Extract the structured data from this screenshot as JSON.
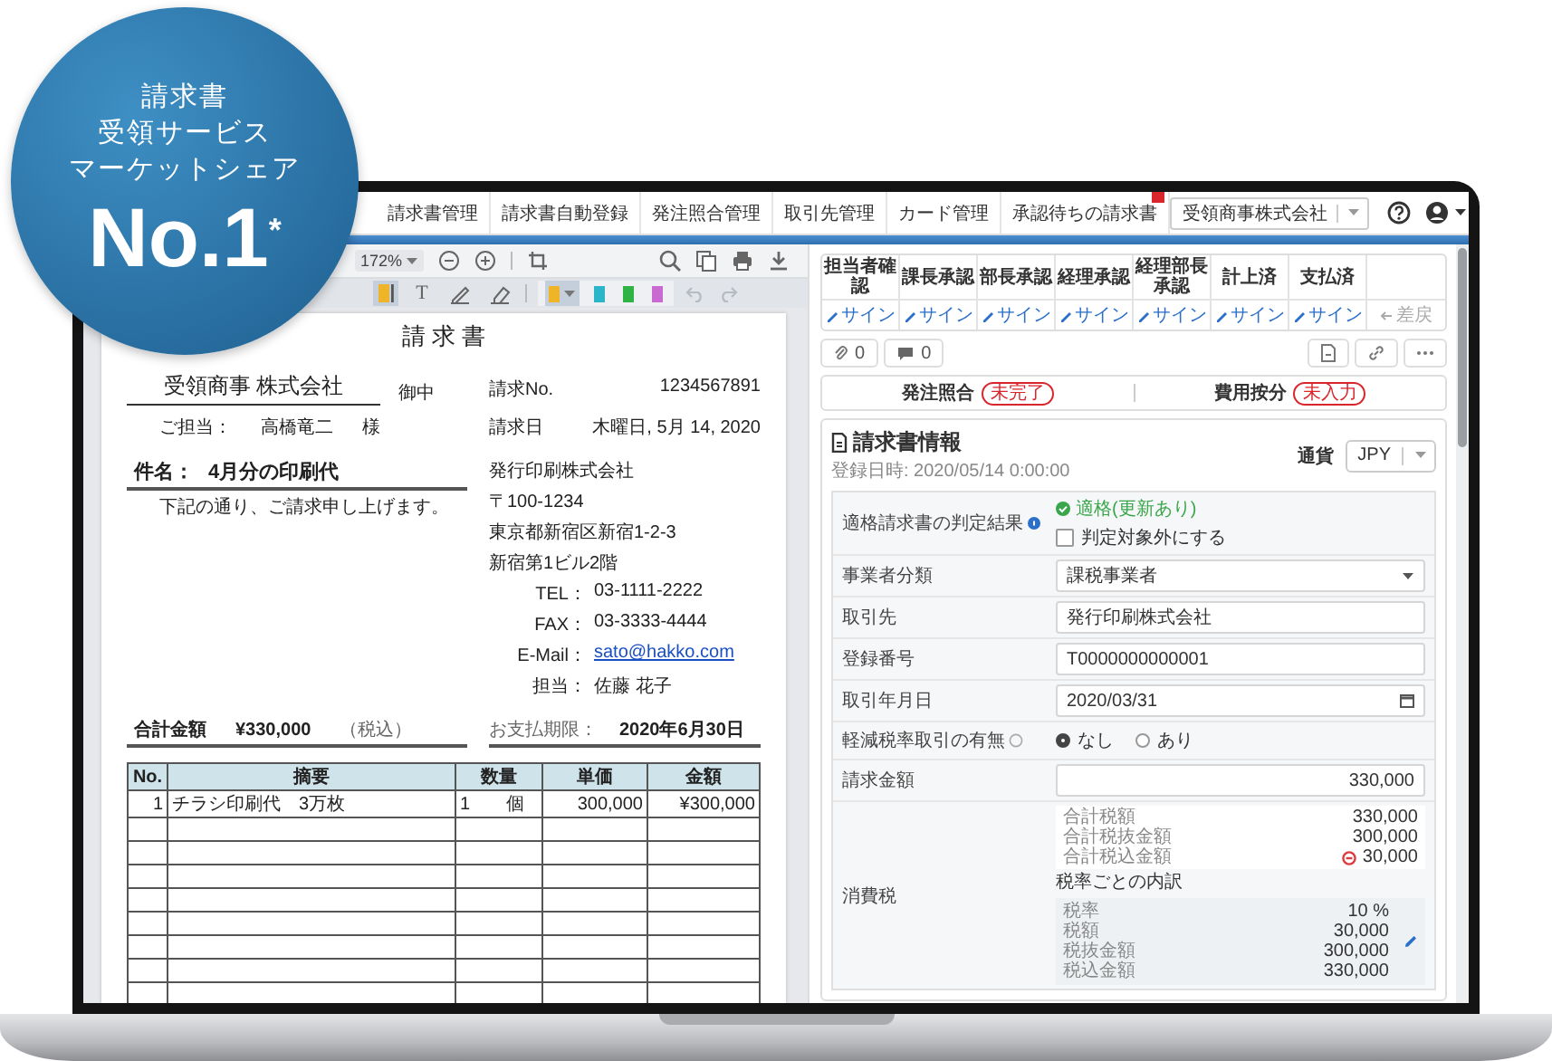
{
  "badge": {
    "lines": [
      "請求書",
      "受領サービス",
      "マーケットシェア"
    ],
    "rank": "No.1$^{*}$"
  },
  "nav": {
    "items": [
      {
        "label": "請求書管理",
        "notice": false
      },
      {
        "label": "請求書自動登録",
        "notice": false
      },
      {
        "label": "発注照合管理",
        "notice": false
      },
      {
        "label": "取引先管理",
        "notice": false
      },
      {
        "label": "カード管理",
        "notice": false
      },
      {
        "label": "承認待ちの請求書",
        "notice": true
      }
    ],
    "company": "受領商事株式会社"
  },
  "viewer": {
    "zoom": "172%",
    "tools": [
      {
        "kind": "highlight",
        "selected": true
      },
      {
        "kind": "text",
        "glyph": "T",
        "selected": false
      },
      {
        "kind": "pen",
        "selected": false
      },
      {
        "kind": "eraser",
        "selected": false
      }
    ],
    "highlight_colors": [
      {
        "color": "#f0b429",
        "selected": true
      },
      {
        "color": "#2bb5c9",
        "selected": false
      },
      {
        "color": "#2fb344",
        "selected": false
      },
      {
        "color": "#c86ad1",
        "selected": false
      }
    ],
    "history": [
      {
        "kind": "undo",
        "disabled": true
      },
      {
        "kind": "redo",
        "disabled": true
      }
    ]
  },
  "document": {
    "title": "請 求 書",
    "recipient": "受領商事 株式会社",
    "honorific": "御中",
    "contact_label": "ご担当：",
    "contact_name": "高橋竜二",
    "contact_suffix": "様",
    "meta": [
      {
        "label": "請求No.",
        "value": "1234567891"
      },
      {
        "label": "請求日",
        "value": "木曜日, 5月 14, 2020"
      }
    ],
    "subject_label": "件名：",
    "subject": "4月分の印刷代",
    "note": "下記の通り、ご請求申し上げます。",
    "issuer": {
      "name": "発行印刷株式会社",
      "address": [
        "〒100-1234",
        "東京都新宿区新宿1-2-3",
        "新宿第1ビル2階"
      ],
      "contacts": [
        {
          "kind": "text",
          "label": "TEL：",
          "value": "03-1111-2222"
        },
        {
          "kind": "text",
          "label": "FAX：",
          "value": "03-3333-4444"
        },
        {
          "kind": "link",
          "label": "E-Mail：",
          "value": "sato@hakko.com"
        },
        {
          "kind": "text",
          "label": "担当：",
          "value": "佐藤 花子"
        }
      ]
    },
    "total_label": "合計金額",
    "total": "¥330,000",
    "tax_note": "（税込）",
    "due_label": "お支払期限：",
    "due": "2020年6月30日",
    "table": {
      "columns": [
        "No.",
        "摘要",
        "数量",
        "単価",
        "金額"
      ],
      "rows": [
        [
          "1",
          "チラシ印刷代　3万枚",
          "1　　個",
          "300,000",
          "¥300,000"
        ]
      ]
    }
  },
  "side": {
    "approvals": [
      {
        "kind": "sign",
        "step": "担当者確認",
        "action": "サイン",
        "disabled": false
      },
      {
        "kind": "sign",
        "step": "課長承認",
        "action": "サイン",
        "disabled": false
      },
      {
        "kind": "sign",
        "step": "部長承認",
        "action": "サイン",
        "disabled": false
      },
      {
        "kind": "sign",
        "step": "経理承認",
        "action": "サイン",
        "disabled": false
      },
      {
        "kind": "sign",
        "step": "経理部長承認",
        "action": "サイン",
        "disabled": false
      },
      {
        "kind": "sign",
        "step": "計上済",
        "action": "サイン",
        "disabled": false
      },
      {
        "kind": "sign",
        "step": "支払済",
        "action": "サイン",
        "disabled": false
      },
      {
        "kind": "return",
        "action": "差戻",
        "disabled": true
      }
    ],
    "counters": [
      {
        "kind": "attachment",
        "count": "0"
      },
      {
        "kind": "comment",
        "count": "0"
      }
    ],
    "actions": [
      {
        "kind": "document"
      },
      {
        "kind": "link"
      },
      {
        "kind": "more"
      }
    ],
    "status": [
      {
        "label": "発注照合",
        "tag": "未完了"
      },
      {
        "label": "費用按分",
        "tag": "未入力"
      }
    ]
  },
  "invoice_info": {
    "title": "請求書情報",
    "registered": "登録日時: 2020/05/14 0:00:00",
    "currency_label": "通貨",
    "currency": "JPY",
    "rows": [
      {
        "kind": "check",
        "label": "適格請求書の判定結果",
        "help": true,
        "result": "適格(更新あり)",
        "checkbox": "判定対象外にする",
        "checked": false
      },
      {
        "kind": "select",
        "label": "事業者分類",
        "value": "課税事業者"
      },
      {
        "kind": "input",
        "label": "取引先",
        "value": "発行印刷株式会社"
      },
      {
        "kind": "input",
        "label": "登録番号",
        "value": "T0000000000001"
      },
      {
        "kind": "date",
        "label": "取引年月日",
        "value": "2020/03/31"
      },
      {
        "kind": "radio",
        "label": "軽減税率取引の有無",
        "hint": true,
        "options": [
          {
            "label": "なし",
            "selected": true
          },
          {
            "label": "あり",
            "selected": false
          }
        ]
      },
      {
        "kind": "amount",
        "label": "請求金額",
        "value": "330,000"
      },
      {
        "kind": "tax",
        "label": "消費税",
        "totals": [
          {
            "label": "合計税額",
            "value": "330,000",
            "warning": false
          },
          {
            "label": "合計税抜金額",
            "value": "300,000",
            "warning": false
          },
          {
            "label": "合計税込金額",
            "value": "30,000",
            "warning": true
          }
        ],
        "breakdown_title": "税率ごとの内訳",
        "breakdown": [
          {
            "label": "税率",
            "value": "10 %"
          },
          {
            "label": "税額",
            "value": "30,000"
          },
          {
            "label": "税抜金額",
            "value": "300,000"
          },
          {
            "label": "税込金額",
            "value": "330,000"
          }
        ]
      }
    ]
  }
}
